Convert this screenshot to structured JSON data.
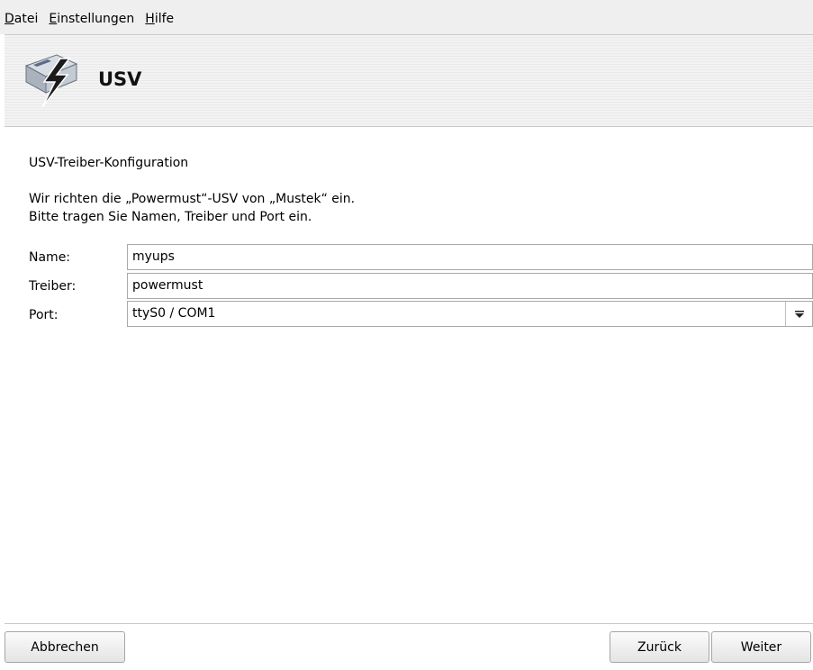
{
  "menu": {
    "items": [
      {
        "mnemonic": "D",
        "rest": "atei"
      },
      {
        "mnemonic": "E",
        "rest": "instellungen"
      },
      {
        "mnemonic": "H",
        "rest": "ilfe"
      }
    ]
  },
  "header": {
    "title": "USV",
    "icon": "ups-power-icon"
  },
  "main": {
    "section_title": "USV-Treiber-Konfiguration",
    "desc_line1": "Wir richten die „Powermust“-USV von „Mustek“ ein.",
    "desc_line2": "Bitte tragen Sie Namen, Treiber und Port ein.",
    "fields": {
      "name": {
        "label": "Name:",
        "value": "myups"
      },
      "driver": {
        "label": "Treiber:",
        "value": "powermust"
      },
      "port": {
        "label": "Port:",
        "value": "ttyS0 / COM1"
      }
    }
  },
  "buttons": {
    "cancel": "Abbrechen",
    "back": "Zurück",
    "next": "Weiter"
  }
}
